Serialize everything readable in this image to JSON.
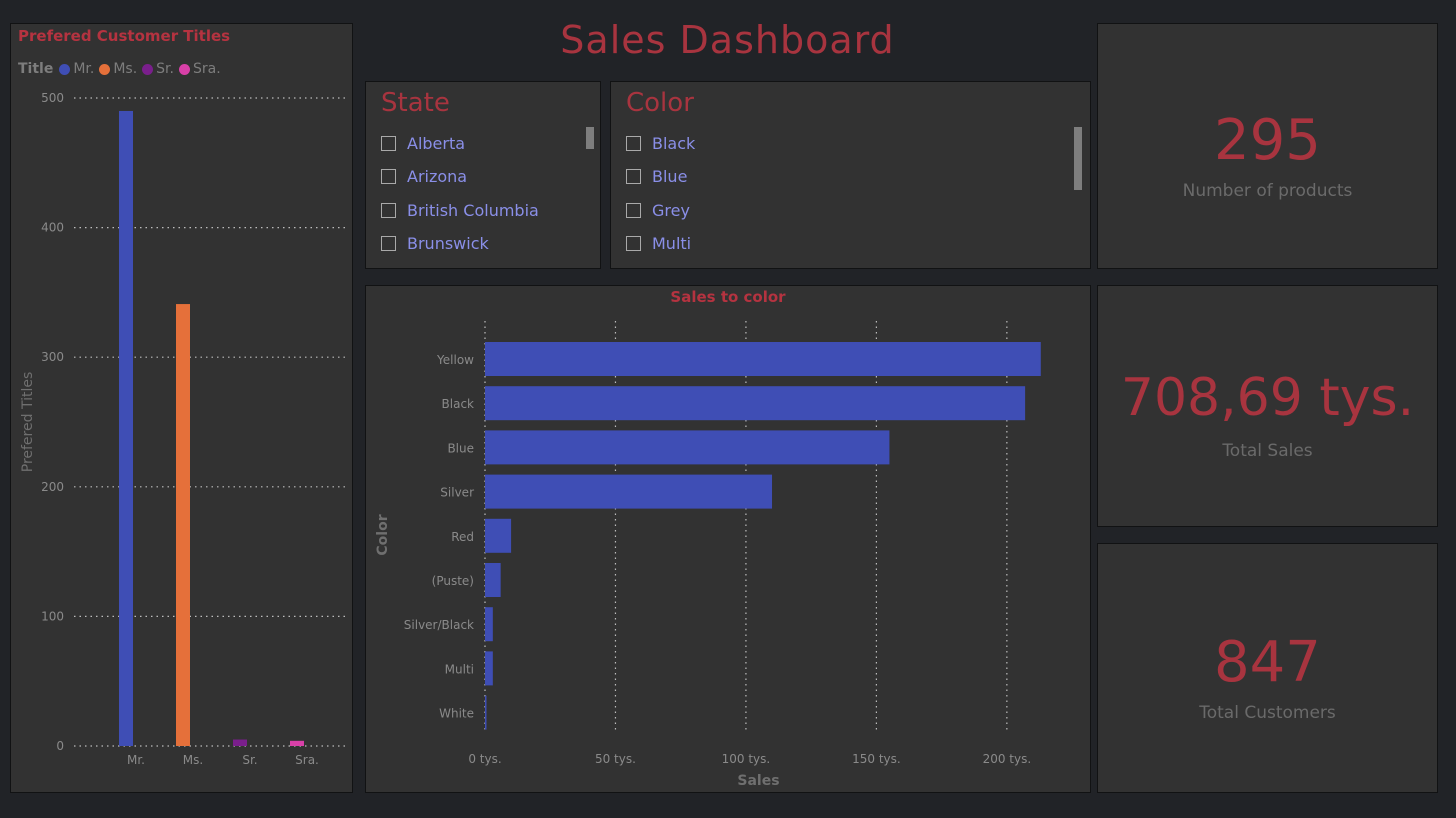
{
  "header": {
    "title": "Sales Dashboard"
  },
  "colors": {
    "accent": "#a8343f",
    "panel": "#323232",
    "background": "#212327",
    "bar": "#3f4eb5"
  },
  "left_chart": {
    "title": "Prefered Customer Titles",
    "legend_title": "Title",
    "chart_data": {
      "type": "bar",
      "title": "Prefered Customer Titles",
      "xlabel": "",
      "ylabel": "Prefered Titles",
      "categories": [
        "Mr.",
        "Ms.",
        "Sr.",
        "Sra."
      ],
      "values": [
        490,
        341,
        5,
        4
      ],
      "colors": [
        "#3f4eb5",
        "#e5703a",
        "#7a1f8c",
        "#d840a8"
      ],
      "legend": [
        "Mr.",
        "Ms.",
        "Sr.",
        "Sra."
      ],
      "ylim": [
        0,
        500
      ],
      "yticks": [
        "0",
        "100",
        "200",
        "300",
        "400",
        "500"
      ],
      "grid": true
    }
  },
  "state_slicer": {
    "title": "State",
    "items": [
      "Alberta",
      "Arizona",
      "British Columbia",
      "Brunswick"
    ]
  },
  "color_slicer": {
    "title": "Color",
    "items": [
      "Black",
      "Blue",
      "Grey",
      "Multi"
    ]
  },
  "cards": {
    "products": {
      "value": "295",
      "label": "Number of products"
    },
    "sales": {
      "value": "708,69 tys.",
      "label": "Total Sales"
    },
    "customers": {
      "value": "847",
      "label": "Total Customers"
    }
  },
  "bar_chart": {
    "title": "Sales to color",
    "chart_data": {
      "type": "bar",
      "orientation": "horizontal",
      "title": "Sales to color",
      "xlabel": "Sales",
      "ylabel": "Color",
      "categories": [
        "Yellow",
        "Black",
        "Blue",
        "Silver",
        "Red",
        "(Puste)",
        "Silver/Black",
        "Multi",
        "White"
      ],
      "values": [
        213,
        207,
        155,
        110,
        10,
        6,
        3,
        3,
        0.5
      ],
      "unit": "tys.",
      "xlim": [
        0,
        215
      ],
      "xticks": [
        "0 tys.",
        "50 tys.",
        "100 tys.",
        "150 tys.",
        "200 tys."
      ],
      "grid": true
    }
  }
}
